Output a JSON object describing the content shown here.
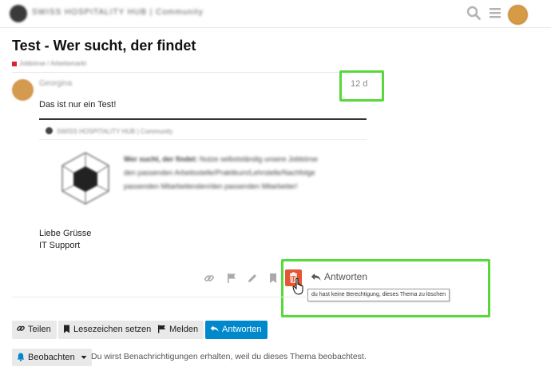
{
  "header": {
    "logo_text": "SWISS HOSPITALITY HUB | Community",
    "search_icon": "search-icon",
    "menu_icon": "hamburger-menu-icon",
    "avatar_color": "#d79a45"
  },
  "topic": {
    "title": "Test - Wer sucht, der findet",
    "category": "Jobbörse / Arbeitsmarkt",
    "category_color": "#dd2233"
  },
  "post": {
    "username": "Georgina",
    "date": "12 d",
    "body_line1": "Das ist nur ein Test!",
    "greeting_line1": "Liebe Grüsse",
    "greeting_line2": "IT Support",
    "embed": {
      "site_name": "SWISS HOSPITALITY HUB | Community",
      "heading": "Wer sucht, der findet:",
      "line1_rest": " Nutze selbstständig unsere Jobbörse",
      "line2": "den passenden Arbeitsstelle/Praktikum/Lehrstelle/Nachfolge",
      "line3": "passenden Mitarbeitenden/den passenden Mitarbeiter!"
    },
    "actions": {
      "link_icon": "link-icon",
      "flag_icon": "flag-icon",
      "edit_icon": "pencil-icon",
      "bookmark_icon": "bookmark-icon",
      "delete_icon": "trash-icon",
      "reply_label": "Antworten",
      "delete_tooltip": "du hast keine Berechtigung, dieses Thema zu löschen"
    }
  },
  "footer_buttons": {
    "share": "Teilen",
    "bookmark": "Lesezeichen setzen",
    "flag": "Melden",
    "reply": "Antworten"
  },
  "notifications": {
    "button_label": "Beobachten",
    "description": "Du wirst Benachrichtigungen erhalten, weil du dieses Thema beobachtest."
  },
  "colors": {
    "primary": "#0088cc",
    "danger": "#e45735",
    "highlight": "#57d93b"
  }
}
